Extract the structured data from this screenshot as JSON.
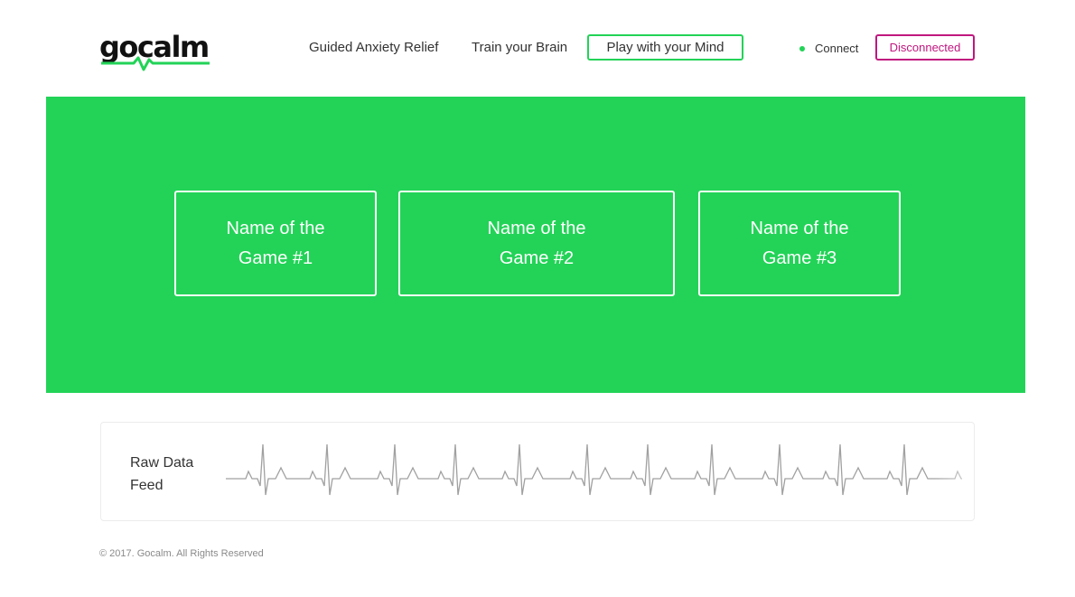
{
  "brand": {
    "logo_text": "gocalm",
    "accent_color": "#22d357"
  },
  "nav": {
    "items": [
      {
        "label": "Guided Anxiety Relief",
        "active": false
      },
      {
        "label": "Train your Brain",
        "active": false
      },
      {
        "label": "Play with your Mind",
        "active": true
      }
    ]
  },
  "connection": {
    "status_icon": "status-dot-icon",
    "connect_label": "Connect",
    "disconnect_label": "Disconnected",
    "disconnect_color": "#c0177f"
  },
  "games": {
    "items": [
      {
        "label": "Name of the Game #1"
      },
      {
        "label": "Name of the Game #2"
      },
      {
        "label": "Name of the Game #3"
      }
    ]
  },
  "feed": {
    "label": "Raw Data Feed",
    "wave_color": "#a0a0a0"
  },
  "footer": {
    "text": "© 2017. Gocalm. All Rights Reserved"
  }
}
